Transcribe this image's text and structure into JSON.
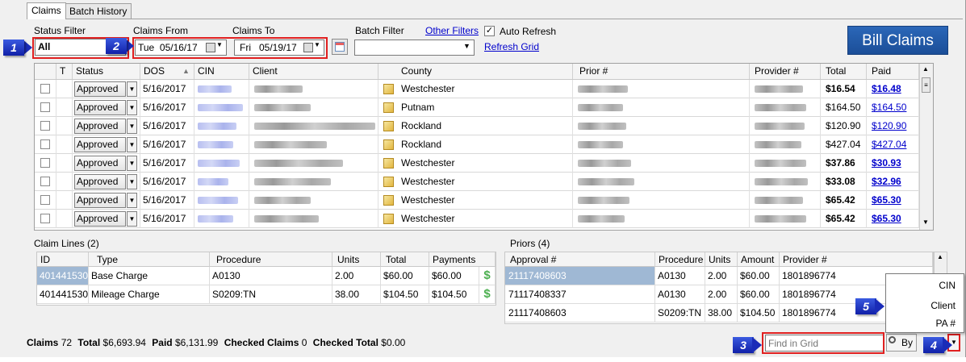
{
  "tabs": [
    "Claims",
    "Batch History"
  ],
  "filters": {
    "status_label": "Status Filter",
    "status_value": "All",
    "claims_from_label": "Claims From",
    "claims_from_value": "Tue  05/16/17",
    "claims_to_label": "Claims To",
    "claims_to_value": "Fri   05/19/17",
    "batch_label": "Batch Filter",
    "batch_value": "",
    "other_filters": "Other Filters",
    "auto_refresh_label": "Auto Refresh",
    "auto_refresh_checked": true,
    "refresh_grid": "Refresh Grid",
    "bill_claims": "Bill Claims"
  },
  "badges": [
    "1",
    "2",
    "3",
    "4",
    "5"
  ],
  "grid": {
    "columns": [
      "T",
      "Status",
      "DOS",
      "CIN",
      "Client",
      "County",
      "Prior #",
      "Provider #",
      "Total",
      "Paid"
    ],
    "rows": [
      {
        "status": "Approved",
        "dos": "5/16/2017",
        "county": "Westchester",
        "total": "$16.54",
        "paid": "$16.48",
        "bold": true
      },
      {
        "status": "Approved",
        "dos": "5/16/2017",
        "county": "Putnam",
        "total": "$164.50",
        "paid": "$164.50",
        "bold": false
      },
      {
        "status": "Approved",
        "dos": "5/16/2017",
        "county": "Rockland",
        "total": "$120.90",
        "paid": "$120.90",
        "bold": false
      },
      {
        "status": "Approved",
        "dos": "5/16/2017",
        "county": "Rockland",
        "total": "$427.04",
        "paid": "$427.04",
        "bold": false
      },
      {
        "status": "Approved",
        "dos": "5/16/2017",
        "county": "Westchester",
        "total": "$37.86",
        "paid": "$30.93",
        "bold": true
      },
      {
        "status": "Approved",
        "dos": "5/16/2017",
        "county": "Westchester",
        "total": "$33.08",
        "paid": "$32.96",
        "bold": true
      },
      {
        "status": "Approved",
        "dos": "5/16/2017",
        "county": "Westchester",
        "total": "$65.42",
        "paid": "$65.30",
        "bold": true
      },
      {
        "status": "Approved",
        "dos": "5/16/2017",
        "county": "Westchester",
        "total": "$65.42",
        "paid": "$65.30",
        "bold": true
      }
    ]
  },
  "claim_lines": {
    "title": "Claim Lines (2)",
    "columns": [
      "ID",
      "Type",
      "Procedure",
      "Units",
      "Total",
      "Payments"
    ],
    "rows": [
      {
        "id": "401441530",
        "type": "Base Charge",
        "procedure": "A0130",
        "units": "2.00",
        "total": "$60.00",
        "payments": "$60.00"
      },
      {
        "id": "401441530",
        "type": "Mileage Charge",
        "procedure": "S0209:TN",
        "units": "38.00",
        "total": "$104.50",
        "payments": "$104.50"
      }
    ]
  },
  "priors": {
    "title": "Priors (4)",
    "columns": [
      "Approval #",
      "Procedure",
      "Units",
      "Amount",
      "Provider #"
    ],
    "rows": [
      {
        "approval": "21117408603",
        "procedure": "A0130",
        "units": "2.00",
        "amount": "$60.00",
        "provider": "1801896774"
      },
      {
        "approval": "71117408337",
        "procedure": "A0130",
        "units": "2.00",
        "amount": "$60.00",
        "provider": "1801896774"
      },
      {
        "approval": "21117408603",
        "procedure": "S0209:TN",
        "units": "38.00",
        "amount": "$104.50",
        "provider": "1801896774"
      }
    ]
  },
  "status_bar": {
    "claims_label": "Claims",
    "claims_value": "72",
    "total_label": "Total",
    "total_value": "$6,693.94",
    "paid_label": "Paid",
    "paid_value": "$6,131.99",
    "checked_claims_label": "Checked Claims",
    "checked_claims_value": "0",
    "checked_total_label": "Checked Total",
    "checked_total_value": "$0.00"
  },
  "find": {
    "placeholder": "Find in Grid",
    "by_label": "By"
  },
  "by_menu": [
    "CIN",
    "Client",
    "PA #"
  ],
  "colors": {
    "accent": "#1b4e98",
    "badge": "#1a2cb8",
    "highlight": "#e02020",
    "link": "#0000cc"
  }
}
